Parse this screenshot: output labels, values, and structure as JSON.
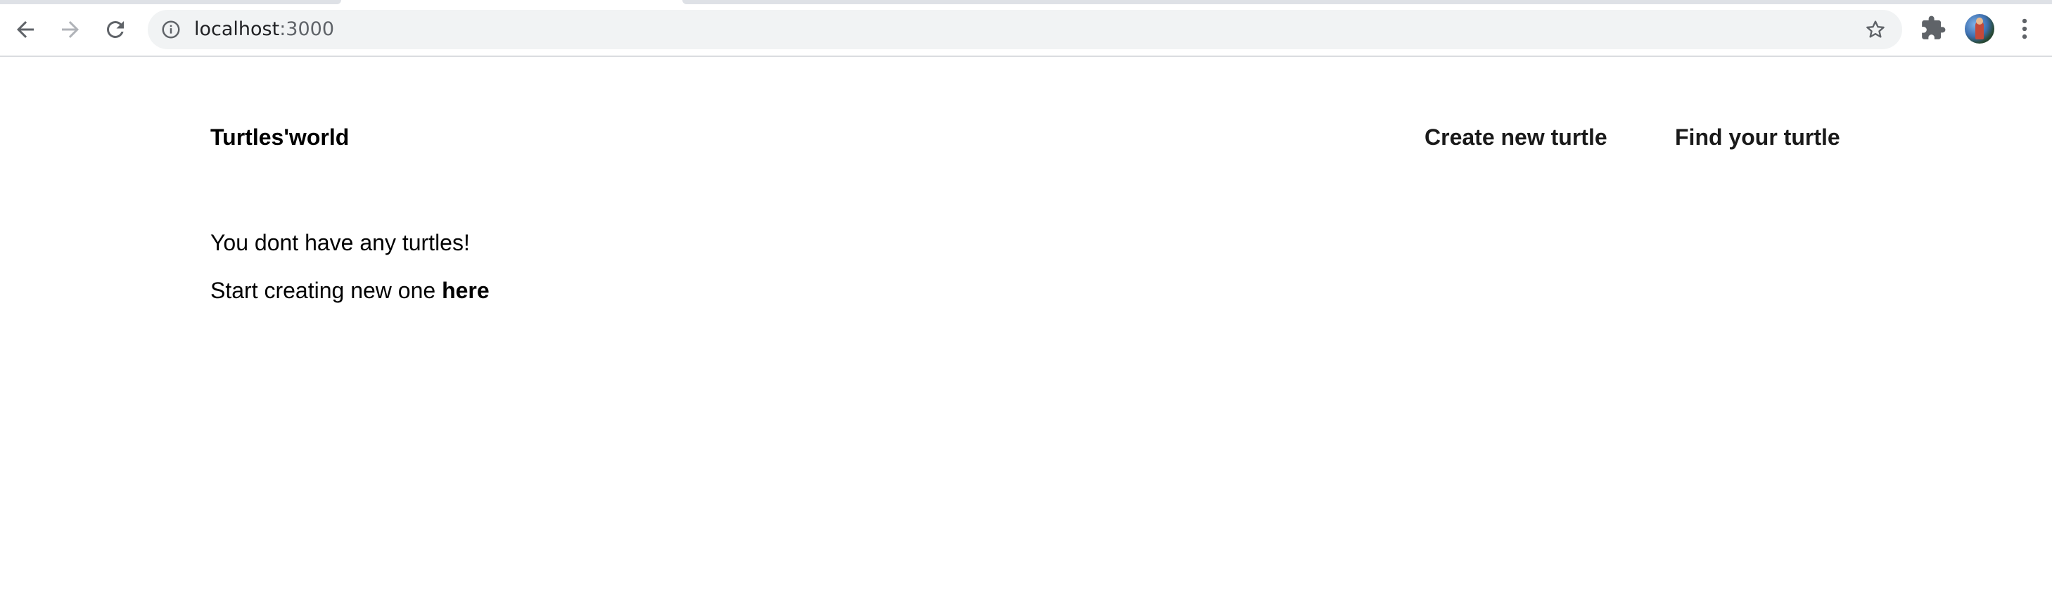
{
  "browser": {
    "url_host": "localhost",
    "url_port": ":3000",
    "icons": {
      "back": "arrow-left-icon",
      "forward": "arrow-right-icon",
      "reload": "reload-icon",
      "site_info": "info-icon",
      "bookmark": "star-icon",
      "extensions": "puzzle-icon",
      "menu": "kebab-menu-icon"
    }
  },
  "header": {
    "brand": "Turtles'world",
    "nav": {
      "create": "Create new turtle",
      "find": "Find your turtle"
    }
  },
  "main": {
    "empty_message": "You dont have any turtles!",
    "start_prefix": "Start creating new one ",
    "start_link": "here"
  },
  "colors": {
    "omnibox_bg": "#f1f3f4",
    "text": "#000000",
    "nav_text": "#1a1a1a",
    "chrome_icon": "#5f6368"
  }
}
